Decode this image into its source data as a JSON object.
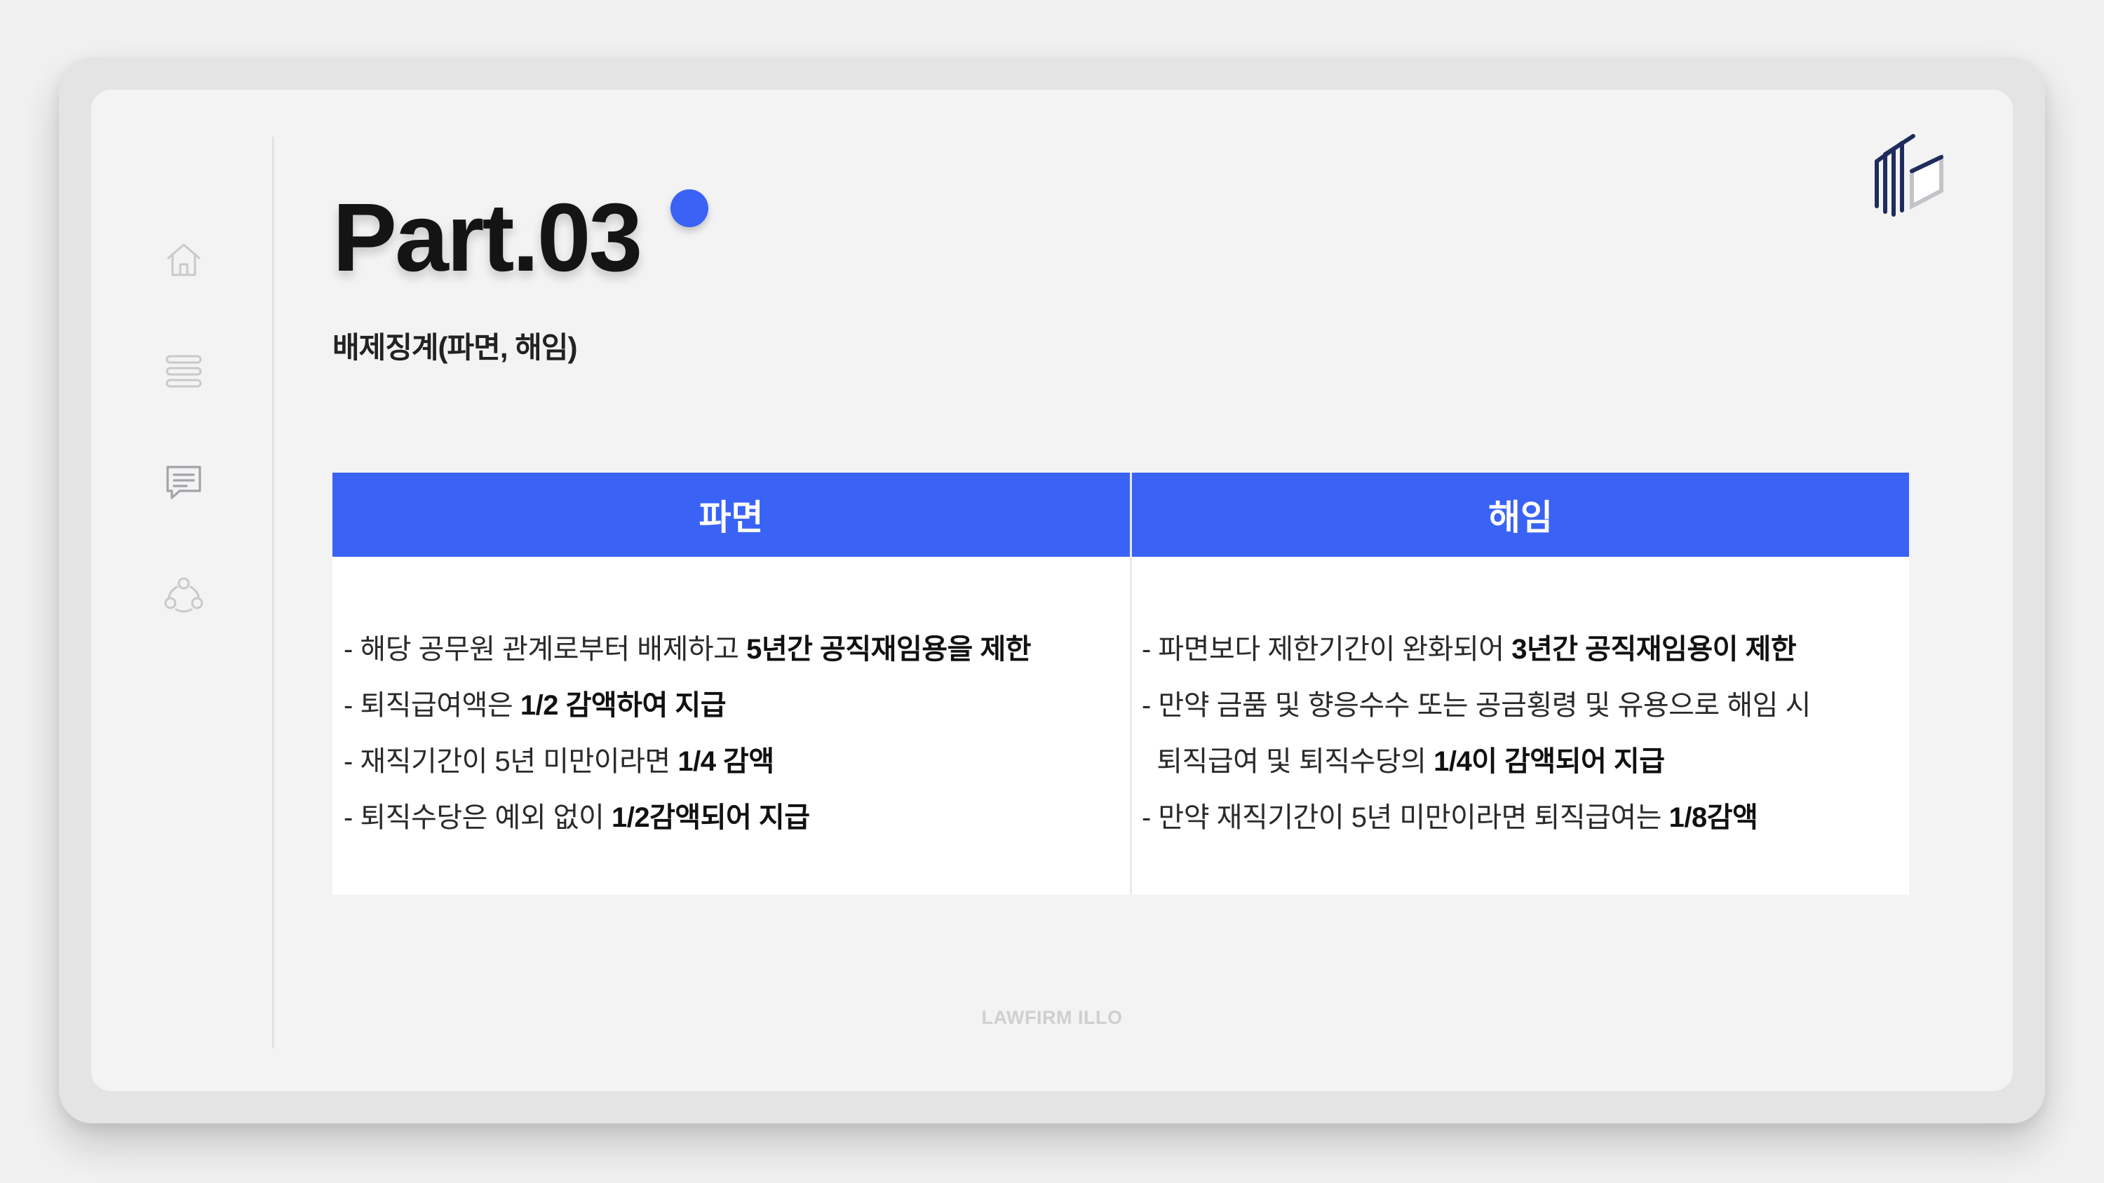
{
  "slide": {
    "title": "Part.03",
    "subtitle": "배제징계(파면, 해임)",
    "footer": "LAWFIRM ILLO",
    "accent_color": "#3a63f5"
  },
  "sidebar": {
    "icons": [
      "home-icon",
      "menu-lines-icon",
      "chat-message-icon",
      "group-users-icon"
    ]
  },
  "logo": {
    "icon": "cube-lines-logo",
    "color": "#1f2d5c"
  },
  "table": {
    "columns": [
      {
        "header": "파면",
        "rows": [
          [
            {
              "t": "- 해당 공무원 관계로부터 배제하고 ",
              "b": false
            },
            {
              "t": "5년간 공직재임용을 제한",
              "b": true
            }
          ],
          [
            {
              "t": "- 퇴직급여액은 ",
              "b": false
            },
            {
              "t": "1/2 감액하여 지급",
              "b": true
            }
          ],
          [
            {
              "t": "- 재직기간이 5년 미만이라면 ",
              "b": false
            },
            {
              "t": "1/4 감액",
              "b": true
            }
          ],
          [
            {
              "t": "- 퇴직수당은 예외 없이 ",
              "b": false
            },
            {
              "t": "1/2감액되어 지급",
              "b": true
            }
          ]
        ]
      },
      {
        "header": "해임",
        "rows": [
          [
            {
              "t": "- 파면보다 제한기간이 완화되어 ",
              "b": false
            },
            {
              "t": "3년간 공직재임용이 제한",
              "b": true
            }
          ],
          [
            {
              "t": "- 만약 금품 및 향응수수 또는 공금횡령 및 유용으로 해임 시",
              "b": false
            }
          ],
          [
            {
              "t": "  퇴직급여 및 퇴직수당의 ",
              "b": false
            },
            {
              "t": "1/4이 감액되어 지급",
              "b": true
            }
          ],
          [
            {
              "t": "- 만약 재직기간이 5년 미만이라면 퇴직급여는 ",
              "b": false
            },
            {
              "t": "1/8감액",
              "b": true
            }
          ]
        ]
      }
    ]
  }
}
